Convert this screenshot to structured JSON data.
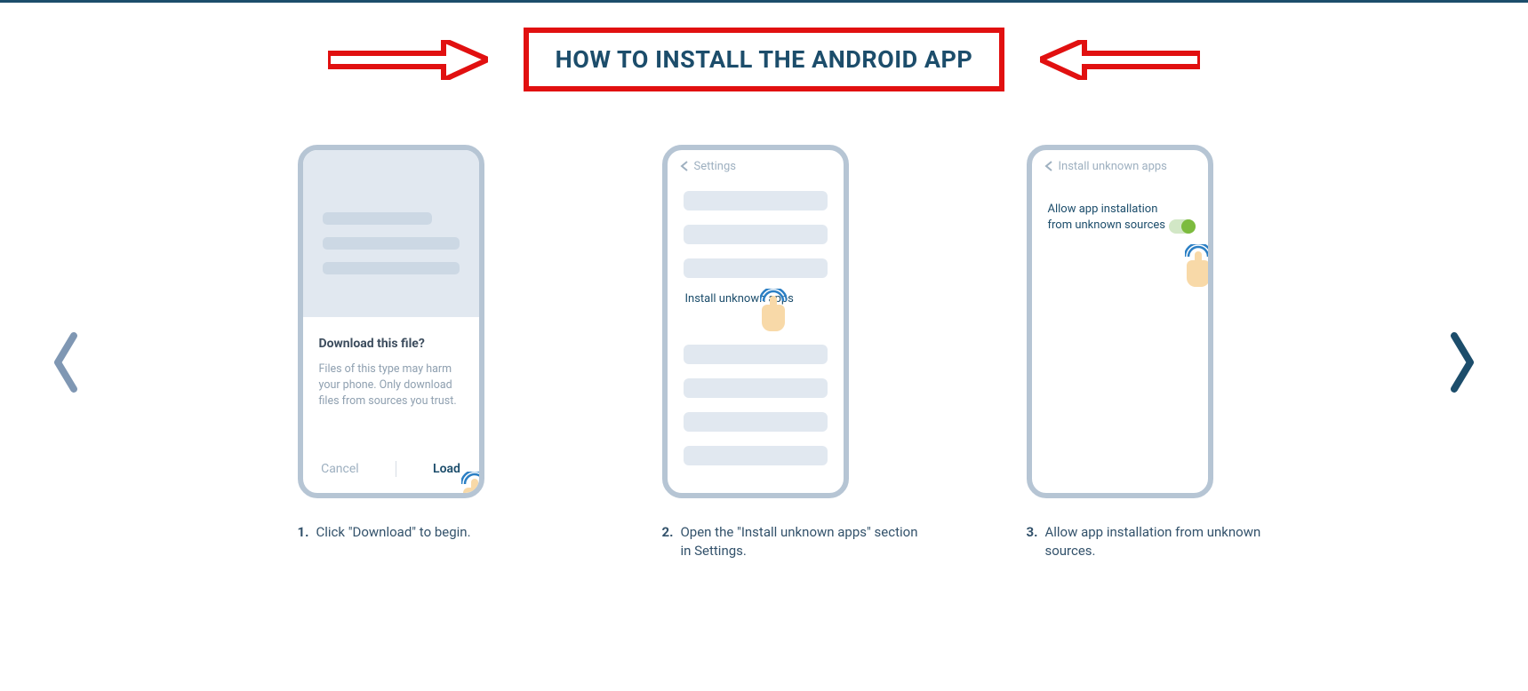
{
  "title": "HOW TO INSTALL THE ANDROID APP",
  "steps": [
    {
      "num": "1.",
      "caption": "Click \"Download\" to begin.",
      "dialog_title": "Download this file?",
      "dialog_body": "Files of this type may harm your phone. Only download files from sources you trust.",
      "cancel": "Cancel",
      "load": "Load"
    },
    {
      "num": "2.",
      "caption": "Open the \"Install unknown apps\" section in Settings.",
      "header": "Settings",
      "link": "Install unknown apps"
    },
    {
      "num": "3.",
      "caption": "Allow app installation from unknown sources.",
      "header": "Install unknown apps",
      "toggle_label": "Allow app installation from unknown sources"
    }
  ]
}
